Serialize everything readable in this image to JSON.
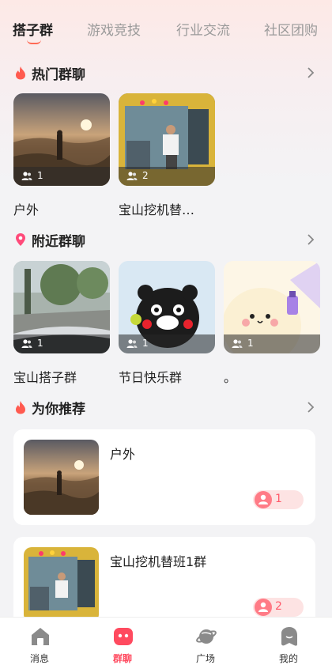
{
  "tabs": [
    {
      "label": "搭子群",
      "active": true
    },
    {
      "label": "游戏竞技",
      "active": false
    },
    {
      "label": "行业交流",
      "active": false
    },
    {
      "label": "社区团购",
      "active": false
    }
  ],
  "hot": {
    "title": "热门群聊",
    "icon": "flame-icon",
    "items": [
      {
        "label": "户外",
        "count": "1",
        "image": "sunset-hiker-photo"
      },
      {
        "label": "宝山挖机替…",
        "count": "2",
        "image": "excavator-operator-photo"
      }
    ]
  },
  "nearby": {
    "title": "附近群聊",
    "icon": "location-pin-icon",
    "items": [
      {
        "label": "宝山搭子群",
        "count": "1",
        "image": "car-windshield-photo"
      },
      {
        "label": "节日快乐群",
        "count": "1",
        "image": "kumamon-photo"
      },
      {
        "label": "。",
        "count": "1",
        "image": "cartoon-blob-photo"
      }
    ]
  },
  "recommend": {
    "title": "为你推荐",
    "icon": "flame-icon",
    "items": [
      {
        "title": "户外",
        "count": "1",
        "image": "sunset-hiker-photo"
      },
      {
        "title": "宝山挖机替班1群",
        "count": "2",
        "image": "excavator-operator-photo"
      }
    ]
  },
  "bottom_nav": [
    {
      "label": "消息",
      "icon": "home-message-icon",
      "active": false
    },
    {
      "label": "群聊",
      "icon": "group-chat-icon",
      "active": true
    },
    {
      "label": "广场",
      "icon": "planet-icon",
      "active": false
    },
    {
      "label": "我的",
      "icon": "profile-icon",
      "active": false
    }
  ],
  "colors": {
    "accent": "#ff4a5f",
    "tab_underline": "#ff6a55",
    "badge_bg": "#fde3e3",
    "badge_icon": "#ff7b86"
  }
}
